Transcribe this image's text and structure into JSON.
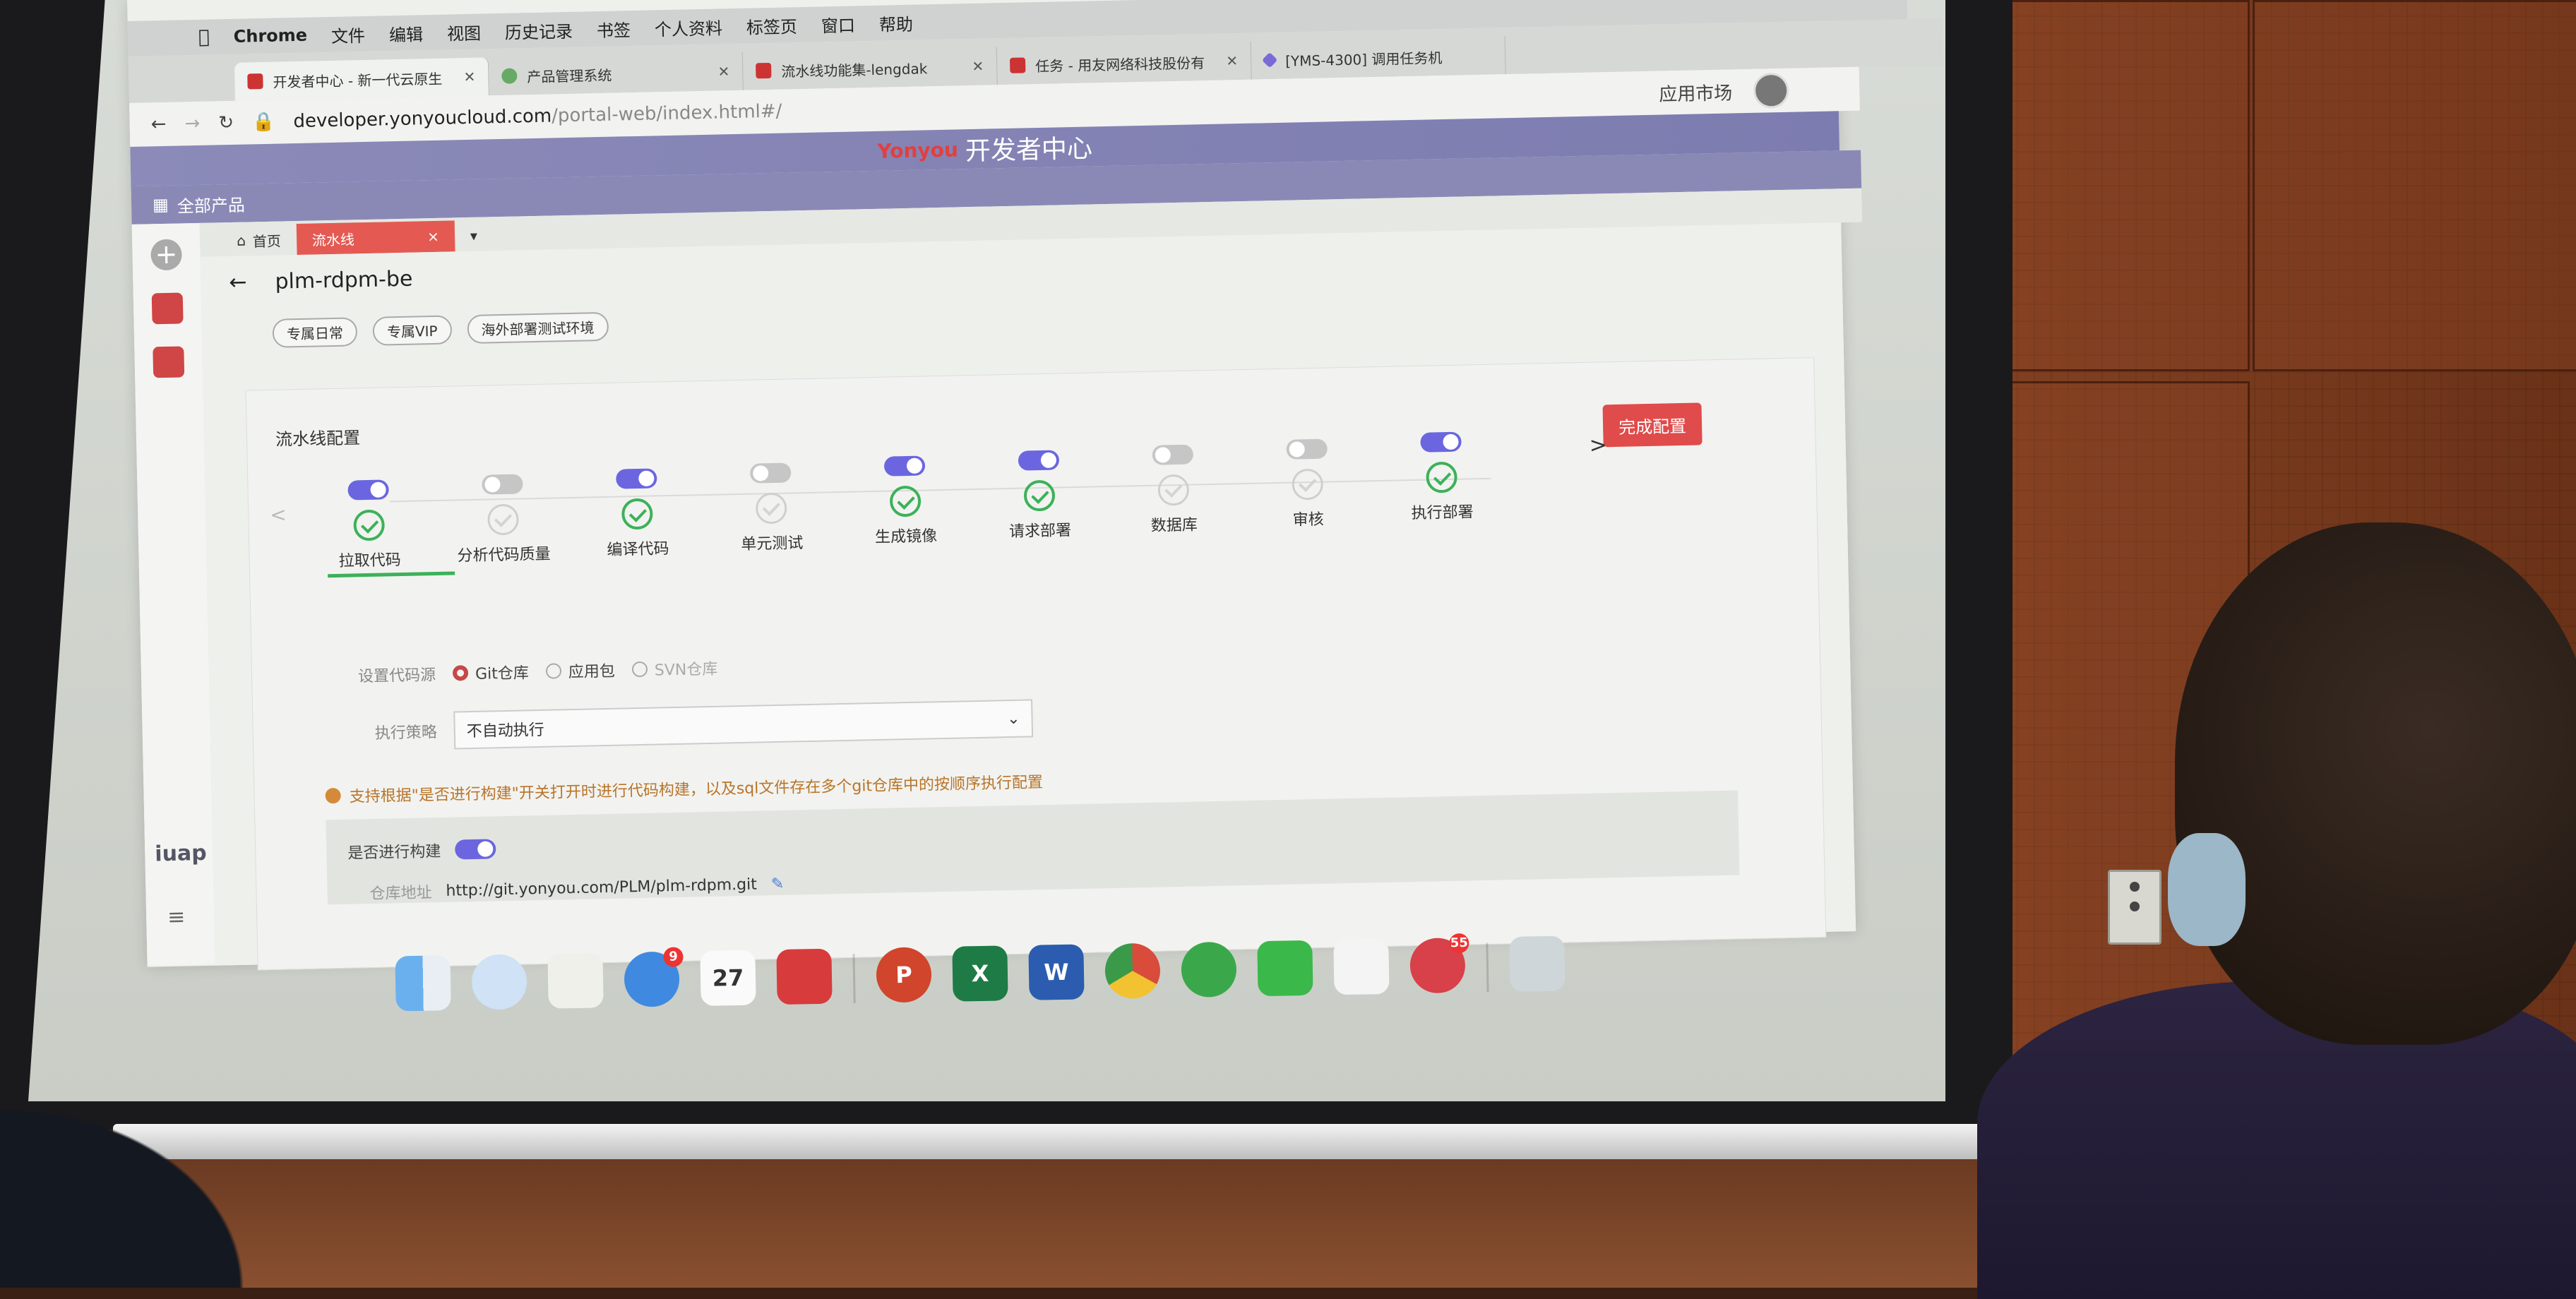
{
  "mac_menubar": {
    "app": "Chrome",
    "items": [
      "文件",
      "编辑",
      "视图",
      "历史记录",
      "书签",
      "个人资料",
      "标签页",
      "窗口",
      "帮助"
    ]
  },
  "browser_tabs": [
    {
      "title": "开发者中心 - 新一代云原生",
      "active": true
    },
    {
      "title": "产品管理系统",
      "active": false
    },
    {
      "title": "流水线功能集-lengdak",
      "active": false
    },
    {
      "title": "任务 - 用友网络科技股份有",
      "active": false
    },
    {
      "title": "[YMS-4300] 调用任务机",
      "active": false
    }
  ],
  "address_bar": {
    "url_host": "developer.yonyoucloud.com",
    "url_path": "/portal-web/index.html#/",
    "app_market": "应用市场"
  },
  "brand": {
    "logo": "Yonyou",
    "title": "开发者中心"
  },
  "product_header": {
    "label": "全部产品"
  },
  "sidebar": {
    "logo": "iuap"
  },
  "app_tabs": [
    {
      "label": "首页",
      "active": false
    },
    {
      "label": "流水线",
      "active": true
    }
  ],
  "page": {
    "title": "plm-rdpm-be",
    "chips": [
      "专属日常",
      "专属VIP",
      "海外部署测试环境"
    ]
  },
  "pipeline": {
    "section_title": "流水线配置",
    "finish_button": "完成配置",
    "prev": "<",
    "next": ">",
    "steps": [
      {
        "label": "拉取代码",
        "enabled": true,
        "done": true
      },
      {
        "label": "分析代码质量",
        "enabled": false,
        "done": false
      },
      {
        "label": "编译代码",
        "enabled": true,
        "done": true
      },
      {
        "label": "单元测试",
        "enabled": false,
        "done": false
      },
      {
        "label": "生成镜像",
        "enabled": true,
        "done": true
      },
      {
        "label": "请求部署",
        "enabled": true,
        "done": true
      },
      {
        "label": "数据库",
        "enabled": false,
        "done": false
      },
      {
        "label": "审核",
        "enabled": false,
        "done": false
      },
      {
        "label": "执行部署",
        "enabled": true,
        "done": true
      }
    ]
  },
  "form": {
    "source_label": "设置代码源",
    "source_options": [
      "Git仓库",
      "应用包",
      "SVN仓库"
    ],
    "source_selected": "Git仓库",
    "strategy_label": "执行策略",
    "strategy_value": "不自动执行",
    "warning": "支持根据\"是否进行构建\"开关打开时进行代码构建，以及sql文件存在多个git仓库中的按顺序执行配置",
    "build_label": "是否进行构建",
    "build_enabled": true,
    "repo_label": "仓库地址",
    "repo_url": "http://git.yonyou.com/PLM/plm-rdpm.git"
  },
  "dock": [
    {
      "name": "finder",
      "label": ""
    },
    {
      "name": "safari",
      "label": ""
    },
    {
      "name": "textedit",
      "label": ""
    },
    {
      "name": "app-store",
      "label": "",
      "badge": "9"
    },
    {
      "name": "calendar",
      "label": "27"
    },
    {
      "name": "app-red",
      "label": ""
    },
    {
      "name": "powerpoint",
      "label": "P"
    },
    {
      "name": "excel",
      "label": "X"
    },
    {
      "name": "word",
      "label": "W"
    },
    {
      "name": "chrome",
      "label": ""
    },
    {
      "name": "evernote",
      "label": ""
    },
    {
      "name": "wechat",
      "label": ""
    },
    {
      "name": "qq",
      "label": ""
    },
    {
      "name": "app-pink",
      "label": "",
      "badge": "55"
    },
    {
      "name": "trash",
      "label": ""
    }
  ],
  "colors": {
    "accent": "#6b66e0",
    "success": "#3cb15a",
    "danger": "#e04b4b",
    "warning": "#b8742a",
    "brand_bar": "#8b8ab8"
  }
}
